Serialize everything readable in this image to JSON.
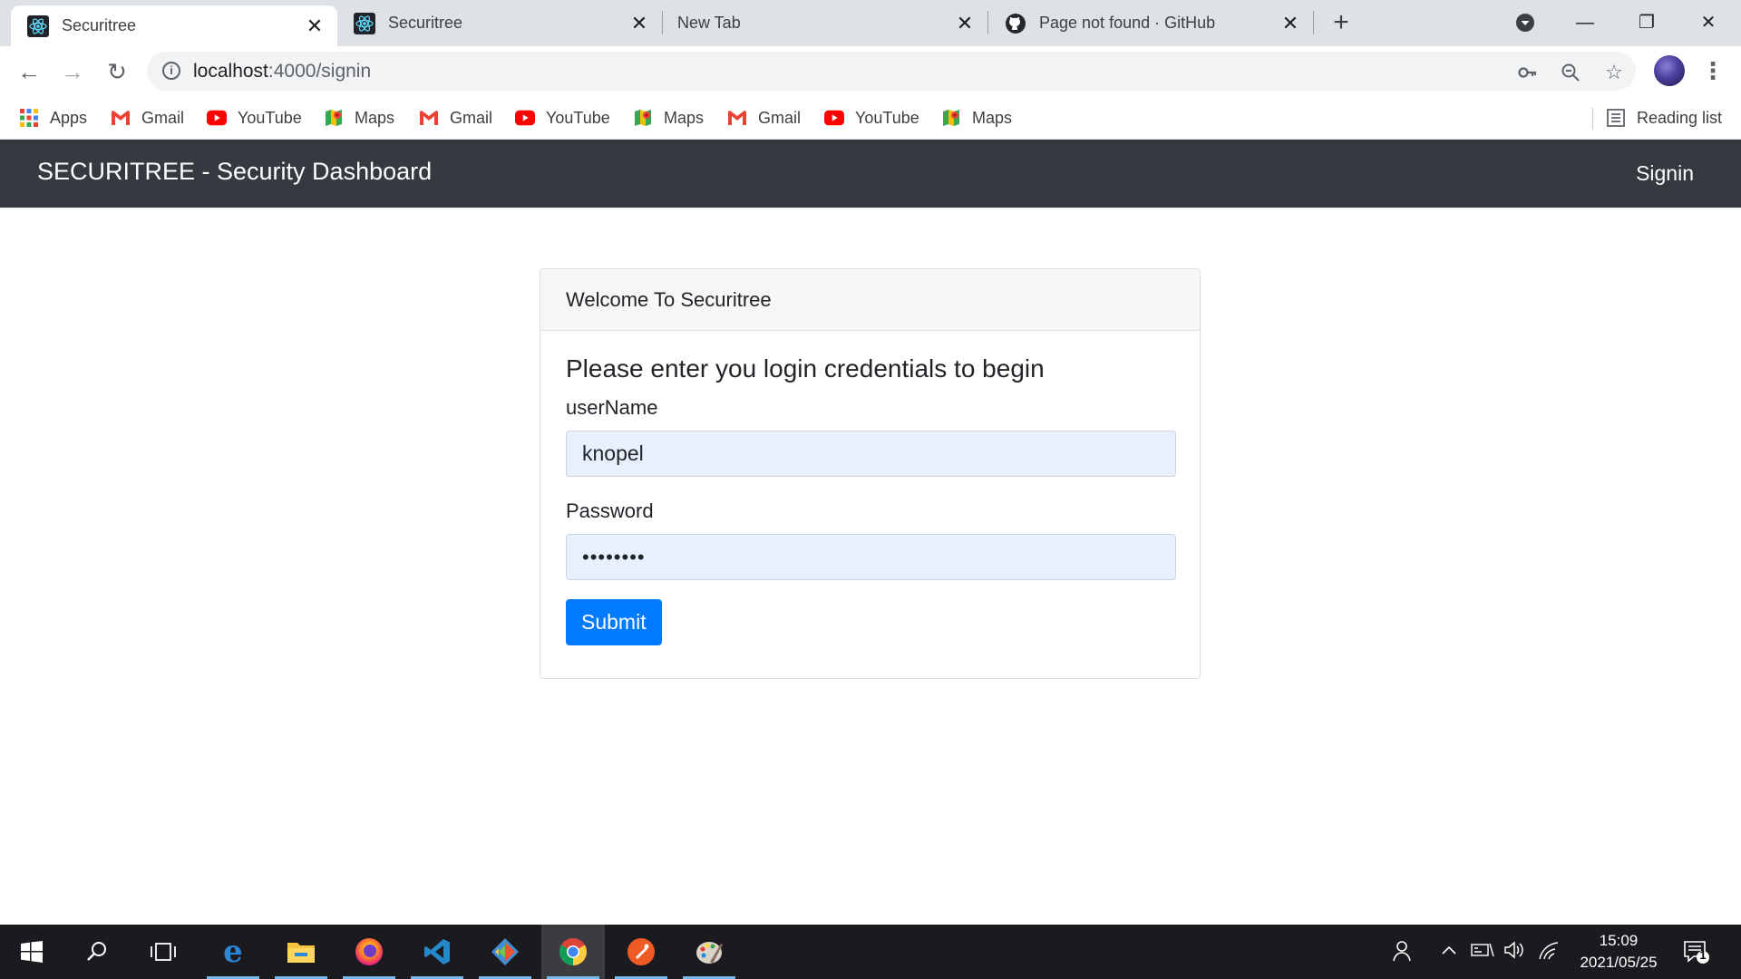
{
  "browser": {
    "tabs": [
      {
        "title": "Securitree",
        "icon": "react-icon",
        "active": true
      },
      {
        "title": "Securitree",
        "icon": "react-icon",
        "active": false
      },
      {
        "title": "New Tab",
        "icon": "",
        "active": false
      },
      {
        "title": "Page not found · GitHub",
        "icon": "github-icon",
        "active": false
      }
    ],
    "url_host": "localhost",
    "url_path": ":4000/signin",
    "bookmarks": [
      {
        "label": "Apps",
        "icon": "apps-grid-icon"
      },
      {
        "label": "Gmail",
        "icon": "gmail-icon"
      },
      {
        "label": "YouTube",
        "icon": "youtube-icon"
      },
      {
        "label": "Maps",
        "icon": "maps-icon"
      },
      {
        "label": "Gmail",
        "icon": "gmail-icon"
      },
      {
        "label": "YouTube",
        "icon": "youtube-icon"
      },
      {
        "label": "Maps",
        "icon": "maps-icon"
      },
      {
        "label": "Gmail",
        "icon": "gmail-icon"
      },
      {
        "label": "YouTube",
        "icon": "youtube-icon"
      },
      {
        "label": "Maps",
        "icon": "maps-icon"
      }
    ],
    "reading_list": "Reading list"
  },
  "navbar": {
    "brand": "SECURITREE - Security Dashboard",
    "signin": "Signin",
    "bg_color": "#343a40"
  },
  "login": {
    "header": "Welcome To Securitree",
    "title": "Please enter you login credentials to begin",
    "username_label": "userName",
    "username_value": "knopel",
    "password_label": "Password",
    "password_mask": "••••••••",
    "submit": "Submit",
    "accent": "#007bff"
  },
  "taskbar": {
    "time": "15:09",
    "date": "2021/05/25",
    "notifications": "1",
    "apps": [
      "windows-start-icon",
      "search-icon",
      "task-view-icon",
      "edge-icon",
      "file-explorer-icon",
      "firefox-icon",
      "vscode-icon",
      "git-gui-icon",
      "chrome-icon",
      "postman-icon",
      "paint-icon"
    ]
  }
}
